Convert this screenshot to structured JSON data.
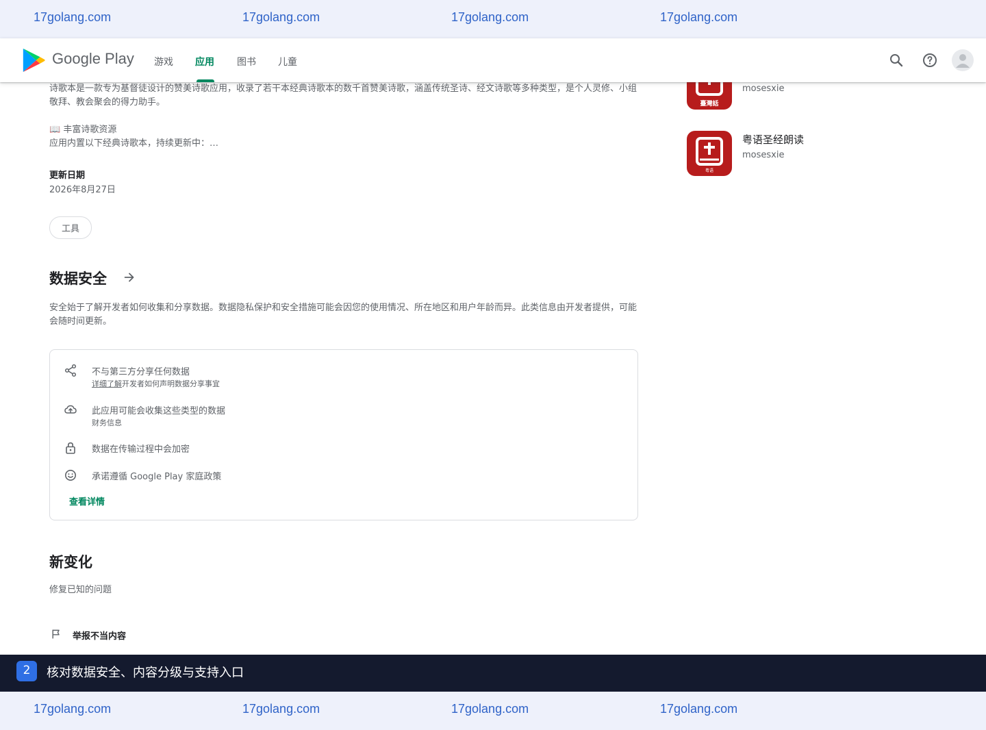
{
  "watermark": {
    "text": "17golang.com"
  },
  "header": {
    "brand": "Google Play",
    "tabs": [
      {
        "label": "游戏",
        "active": false
      },
      {
        "label": "应用",
        "active": true
      },
      {
        "label": "图书",
        "active": false
      },
      {
        "label": "儿童",
        "active": false
      }
    ],
    "icons": [
      "search-icon",
      "help-icon",
      "account-avatar"
    ]
  },
  "about": {
    "description": "诗歌本是一款专为基督徒设计的赞美诗歌应用，收录了若干本经典诗歌本的数千首赞美诗歌，涵盖传统圣诗、经文诗歌等多种类型，是个人灵修、小组敬拜、教会聚会的得力助手。",
    "feature_title": "📖 丰富诗歌资源",
    "feature_desc": "应用内置以下经典诗歌本，持续更新中：…",
    "updated_label": "更新日期",
    "updated_value": "2026年8月27日",
    "category_chip": "工具"
  },
  "data_safety": {
    "title": "数据安全",
    "intro": "安全始于了解开发者如何收集和分享数据。数据隐私保护和安全措施可能会因您的使用情况、所在地区和用户年龄而异。此类信息由开发者提供，可能会随时间更新。",
    "rows": [
      {
        "icon": "share-icon",
        "title": "不与第三方分享任何数据",
        "link": "详细了解",
        "sub": "开发者如何声明数据分享事宜"
      },
      {
        "icon": "cloud-upload-icon",
        "title": "此应用可能会收集这些类型的数据",
        "sub": "财务信息"
      },
      {
        "icon": "lock-icon",
        "title": "数据在传输过程中会加密"
      },
      {
        "icon": "smiley-icon",
        "title": "承诺遵循 Google Play 家庭政策"
      }
    ],
    "details_link": "查看详情"
  },
  "whats_new": {
    "title": "新变化",
    "body": "修复已知的问题"
  },
  "report": {
    "label": "举报不当内容"
  },
  "similar_apps": [
    {
      "icon_label": "臺灣話",
      "developer": "mosesxie"
    },
    {
      "name": "粤语圣经朗读",
      "icon_label": "粤语",
      "developer": "mosesxie"
    }
  ],
  "caption": {
    "step": "2",
    "text": "核对数据安全、内容分级与支持入口"
  },
  "colors": {
    "accent": "#01875f",
    "app_icon": "#b71c1c",
    "caption_bg": "#141a2e",
    "watermark": "#2f63c8"
  }
}
